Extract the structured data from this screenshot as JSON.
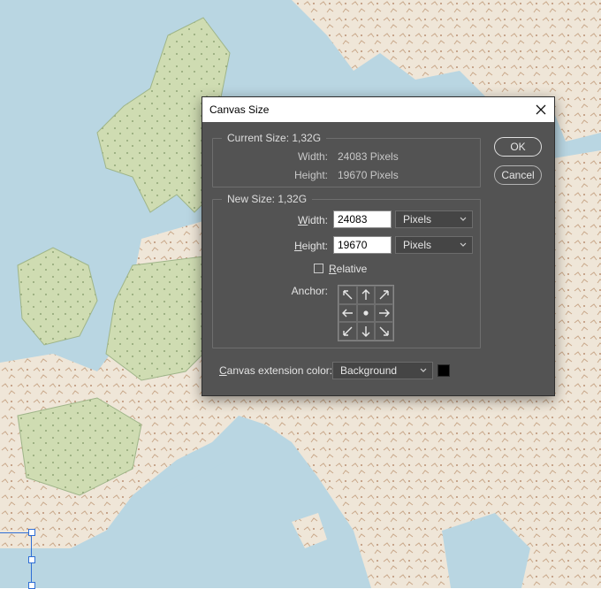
{
  "dialog": {
    "title": "Canvas Size",
    "close_icon": "close-icon",
    "current_size": {
      "legend": "Current Size: 1,32G",
      "width_label": "Width:",
      "width_value": "24083 Pixels",
      "height_label": "Height:",
      "height_value": "19670 Pixels"
    },
    "new_size": {
      "legend": "New Size: 1,32G",
      "width_label_accel": "W",
      "width_label_rest": "idth:",
      "width_value": "24083",
      "width_unit": "Pixels",
      "height_label_accel": "H",
      "height_label_rest": "eight:",
      "height_value": "19670",
      "height_unit": "Pixels",
      "relative_label_accel": "R",
      "relative_label_rest": "elative",
      "relative_checked": false,
      "anchor_label": "Anchor:",
      "anchor_icons": [
        "arrow-up-left-icon",
        "arrow-up-icon",
        "arrow-up-right-icon",
        "arrow-left-icon",
        "anchor-center-dot-icon",
        "arrow-right-icon",
        "arrow-down-left-icon",
        "arrow-down-icon",
        "arrow-down-right-icon"
      ]
    },
    "extension_color": {
      "label_accel": "C",
      "label_rest": "anvas extension color:",
      "value": "Background",
      "swatch_color": "#000000"
    },
    "buttons": {
      "ok": "OK",
      "cancel": "Cancel"
    }
  },
  "colors": {
    "dialog_bg": "#535353",
    "selection_blue": "#2f6fd6"
  }
}
